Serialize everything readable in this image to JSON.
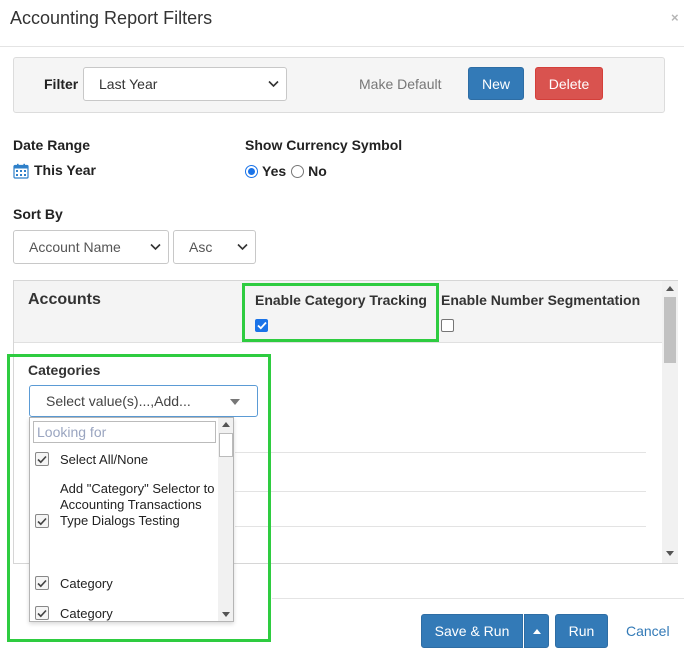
{
  "dialog": {
    "title": "Accounting Report Filters",
    "close_glyph": "×"
  },
  "filter": {
    "label": "Filter",
    "selected": "Last Year",
    "make_default_label": "Make Default",
    "new_label": "New",
    "delete_label": "Delete"
  },
  "date_range": {
    "label": "Date Range",
    "value": "This Year",
    "icon": "calendar-icon"
  },
  "currency": {
    "label": "Show Currency Symbol",
    "yes_label": "Yes",
    "no_label": "No",
    "selected": "Yes"
  },
  "sort": {
    "label": "Sort By",
    "field": "Account Name",
    "direction": "Asc"
  },
  "accounts_panel": {
    "title": "Accounts",
    "enable_category_tracking": {
      "label": "Enable Category Tracking",
      "checked": true
    },
    "enable_number_segmentation": {
      "label": "Enable Number Segmentation",
      "checked": false
    }
  },
  "categories": {
    "label": "Categories",
    "select_text": "Select value(s)...,Add...",
    "search_placeholder": "Looking for",
    "options": [
      {
        "label": "Select All/None",
        "checked": true
      },
      {
        "label": "Add \"Category\" Selector to Accounting Transactions Type Dialogs Testing",
        "checked": true
      },
      {
        "label": "Category",
        "checked": true
      },
      {
        "label": "Category",
        "checked": true
      }
    ]
  },
  "footer": {
    "save_run_label": "Save & Run",
    "run_label": "Run",
    "cancel_label": "Cancel"
  },
  "colors": {
    "primary": "#337ab7",
    "danger": "#d9534f",
    "highlight": "#2ecc40",
    "checkbox_blue": "#1a73e8"
  }
}
